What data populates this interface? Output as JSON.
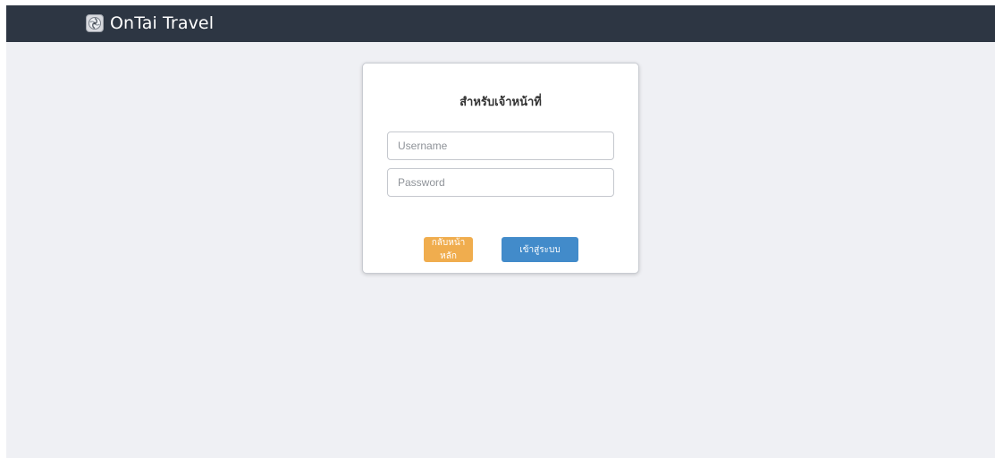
{
  "header": {
    "brand_name": "OnTai Travel",
    "logo_icon": "swirl-logo-icon",
    "background_color": "#2d3643"
  },
  "login_card": {
    "title": "สำหรับเจ้าหน้าที่",
    "username_placeholder": "Username",
    "password_placeholder": "Password",
    "back_button_label": "กลับหน้าหลัก",
    "login_button_label": "เข้าสู่ระบบ",
    "back_button_color": "#f0ad4e",
    "login_button_color": "#428bca"
  },
  "page": {
    "background_color": "#eff0f4"
  }
}
